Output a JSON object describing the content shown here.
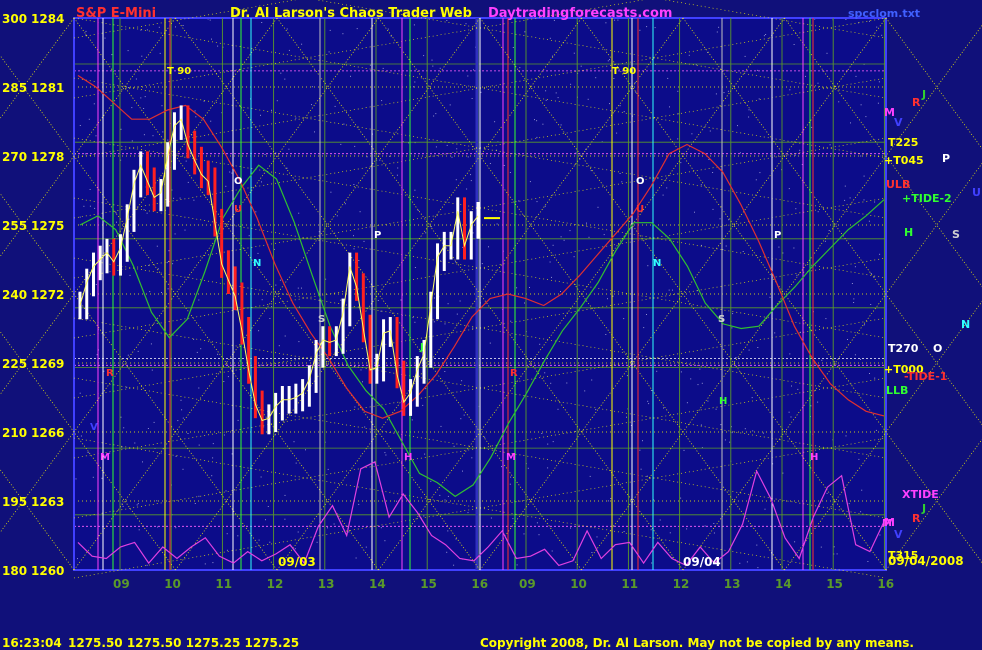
{
  "header": {
    "title_left": "S&P E-Mini",
    "title_center": "Dr. Al Larson's Chaos Trader Web",
    "site": "Daytradingforecasts.com",
    "file": "spcclom.txt"
  },
  "footer": {
    "time": "16:23:04",
    "quotes": "1275.50 1275.50 1275.25 1275.25",
    "copyright": "Copyright 2008, Dr. Al Larson. May not be copied by any means."
  },
  "colors": {
    "background": "#10107a",
    "plot_bg": "#0c0c8a",
    "grid": "#5a9a2a",
    "yellow": "#ffff00",
    "price_up": "#ffffff",
    "price_down": "#ff2020",
    "red_line": "#e03030",
    "green_line": "#30c030",
    "magenta_line": "#e040e0"
  },
  "chart_data": {
    "type": "line",
    "title": "S&P E-Mini",
    "y_left_labels": [
      "300",
      "285",
      "270",
      "255",
      "240",
      "225",
      "210",
      "195",
      "180"
    ],
    "y_right_labels": [
      "1284",
      "1281",
      "1278",
      "1275",
      "1272",
      "1269",
      "1266",
      "1263",
      "1260"
    ],
    "ylim": [
      1260,
      1284
    ],
    "x_ticks": [
      "09",
      "10",
      "11",
      "12",
      "13",
      "14",
      "15",
      "16",
      "09",
      "10",
      "11",
      "12",
      "13",
      "14",
      "15",
      "16"
    ],
    "date_labels": [
      "09/03",
      "09/04"
    ],
    "end_date": "09/04/2008",
    "right_labels": [
      {
        "text": "M",
        "color": "#ff40ff"
      },
      {
        "text": "R",
        "color": "#ff3030"
      },
      {
        "text": "J",
        "color": "#30d030"
      },
      {
        "text": "V",
        "color": "#4040ff"
      },
      {
        "text": "T225",
        "color": "#ffff00"
      },
      {
        "text": "+T045",
        "color": "#ffff00"
      },
      {
        "text": "P",
        "color": "#ffffff"
      },
      {
        "text": "ULB",
        "color": "#ff3030"
      },
      {
        "text": "+TIDE-2",
        "color": "#30ff30"
      },
      {
        "text": "U",
        "color": "#4040ff"
      },
      {
        "text": "H",
        "color": "#30ff30"
      },
      {
        "text": "S",
        "color": "#d0d0d0"
      },
      {
        "text": "N",
        "color": "#30ffff"
      },
      {
        "text": "T270",
        "color": "#ffffff"
      },
      {
        "text": "O",
        "color": "#ffffff"
      },
      {
        "text": "+T000",
        "color": "#ffff00"
      },
      {
        "text": "-TIDE-1",
        "color": "#ff3030"
      },
      {
        "text": "LLB",
        "color": "#30ff30"
      },
      {
        "text": "XTIDE",
        "color": "#ff40ff"
      },
      {
        "text": "R",
        "color": "#ff3030"
      },
      {
        "text": "J",
        "color": "#30d030"
      },
      {
        "text": "M",
        "color": "#ff40ff"
      },
      {
        "text": "V",
        "color": "#4040ff"
      },
      {
        "text": "T315",
        "color": "#ffff00"
      }
    ],
    "plot_labels": [
      {
        "text": "T 90",
        "color": "#ffff00"
      },
      {
        "text": "T 90",
        "color": "#ffff00"
      },
      {
        "text": "O",
        "color": "#ffffff"
      },
      {
        "text": "O",
        "color": "#ffffff"
      },
      {
        "text": "U",
        "color": "#ff3030"
      },
      {
        "text": "U",
        "color": "#ff3030"
      },
      {
        "text": "N",
        "color": "#30ffff"
      },
      {
        "text": "N",
        "color": "#30ffff"
      },
      {
        "text": "P",
        "color": "#ffffff"
      },
      {
        "text": "P",
        "color": "#ffffff"
      },
      {
        "text": "S",
        "color": "#d0d0d0"
      },
      {
        "text": "S",
        "color": "#d0d0d0"
      },
      {
        "text": "H",
        "color": "#30ff30"
      },
      {
        "text": "H",
        "color": "#ff40ff"
      },
      {
        "text": "J",
        "color": "#30ff30"
      },
      {
        "text": "R",
        "color": "#ff3030"
      },
      {
        "text": "R",
        "color": "#ff3030"
      },
      {
        "text": "V",
        "color": "#4040ff"
      },
      {
        "text": "M",
        "color": "#ff40ff"
      },
      {
        "text": "M",
        "color": "#ff40ff"
      },
      {
        "text": "M",
        "color": "#ff40ff"
      },
      {
        "text": "H",
        "color": "#ff40ff"
      }
    ],
    "series": [
      {
        "name": "price",
        "values": [
          1271.5,
          1272.5,
          1273.2,
          1273.5,
          1273.8,
          1273.4,
          1274.0,
          1275.3,
          1276.8,
          1277.6,
          1276.9,
          1276.2,
          1276.4,
          1278.0,
          1279.3,
          1279.6,
          1278.5,
          1277.8,
          1277.2,
          1276.9,
          1275.1,
          1273.3,
          1272.6,
          1271.9,
          1270.4,
          1268.7,
          1267.2,
          1266.5,
          1266.6,
          1267.1,
          1267.4,
          1267.4,
          1267.5,
          1267.7,
          1268.3,
          1269.4,
          1270.0,
          1269.9,
          1270.0,
          1271.2,
          1273.2,
          1272.3,
          1270.5,
          1268.7,
          1268.8,
          1270.3,
          1270.4,
          1268.5,
          1267.3,
          1267.7,
          1268.7,
          1269.4,
          1271.5,
          1273.6,
          1274.1,
          1274.1,
          1275.6,
          1274.1,
          1275.0,
          1275.4
        ]
      },
      {
        "name": "green",
        "values": [
          1275,
          1275.4,
          1274.8,
          1273.2,
          1271.2,
          1270.1,
          1270.9,
          1273.0,
          1275.3,
          1276.6,
          1277.6,
          1277.0,
          1275.1,
          1272.8,
          1270.6,
          1268.9,
          1267.8,
          1267.0,
          1265.6,
          1264.2,
          1263.8,
          1263.2,
          1263.7,
          1264.9,
          1266.4,
          1267.7,
          1269.1,
          1270.4,
          1271.4,
          1272.5,
          1273.9,
          1275.1,
          1275.1,
          1274.4,
          1273.2,
          1271.6,
          1270.7,
          1270.5,
          1270.6,
          1271.5,
          1272.3,
          1273.2,
          1274.0,
          1274.8,
          1275.4,
          1276.1
        ]
      },
      {
        "name": "red",
        "values": [
          1281.5,
          1281.0,
          1280.3,
          1279.6,
          1279.6,
          1280.0,
          1280.2,
          1279.6,
          1278.4,
          1277.0,
          1275.3,
          1273.3,
          1271.6,
          1270.3,
          1269.2,
          1267.9,
          1266.9,
          1266.6,
          1266.9,
          1267.6,
          1268.5,
          1269.7,
          1271.0,
          1271.8,
          1272.0,
          1271.8,
          1271.5,
          1272.0,
          1272.8,
          1273.7,
          1274.6,
          1275.5,
          1276.7,
          1278.1,
          1278.5,
          1278.1,
          1277.3,
          1275.9,
          1274.3,
          1272.5,
          1270.6,
          1269.2,
          1268.1,
          1267.4,
          1266.9,
          1266.7
        ]
      },
      {
        "name": "magenta",
        "values": [
          1261.2,
          1260.6,
          1260.5,
          1261.0,
          1261.2,
          1260.3,
          1261.0,
          1260.5,
          1261.0,
          1261.4,
          1260.6,
          1260.3,
          1260.8,
          1260.4,
          1260.7,
          1261.1,
          1260.3,
          1261.9,
          1262.8,
          1261.5,
          1264.4,
          1264.7,
          1262.3,
          1263.3,
          1262.5,
          1261.5,
          1261.1,
          1260.5,
          1260.4,
          1261.0,
          1261.7,
          1260.5,
          1260.6,
          1260.9,
          1260.2,
          1260.4,
          1261.7,
          1260.5,
          1261.1,
          1261.2,
          1260.3,
          1261.2,
          1260.5,
          1260.2,
          1261.0,
          1260.3,
          1260.8,
          1262.0,
          1264.3,
          1263.1,
          1261.4,
          1260.5,
          1262.3,
          1263.6,
          1264.1,
          1261.1,
          1260.8,
          1262.1
        ]
      }
    ]
  }
}
